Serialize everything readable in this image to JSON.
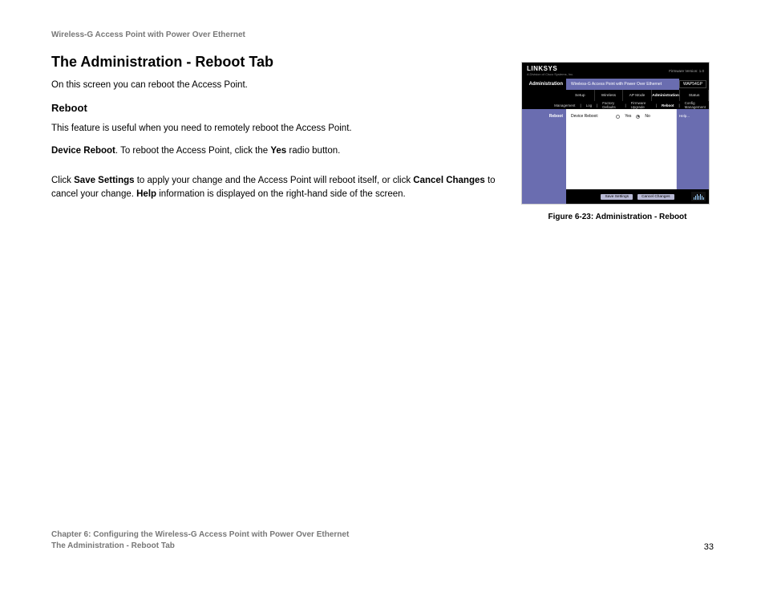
{
  "header": "Wireless-G Access Point with Power Over Ethernet",
  "title": "The Administration - Reboot Tab",
  "intro": "On this screen you can reboot the Access Point.",
  "subheading": "Reboot",
  "p1": "This feature is useful when you need to remotely reboot the Access Point.",
  "p2a": "Device Reboot",
  "p2b": ". To reboot the Access Point, click the ",
  "p2c": "Yes",
  "p2d": " radio button.",
  "p3a": "Click ",
  "p3b": "Save Settings",
  "p3c": " to apply your change and the Access Point will reboot itself, or click ",
  "p3d": "Cancel Changes",
  "p3e": " to cancel your change. ",
  "p3f": "Help",
  "p3g": " information is displayed on the right-hand side of the screen.",
  "figure": {
    "caption": "Figure 6-23: Administration - Reboot",
    "logo": "LINKSYS",
    "tagline": "A Division of Cisco Systems, Inc.",
    "fw": "Firmware Version: 1.0",
    "section": "Administration",
    "product": "Wireless-G Access Point with Power Over Ethernet",
    "model": "WAP54GP",
    "tabs": [
      "Setup",
      "Wireless",
      "AP Mode",
      "Administration",
      "Status"
    ],
    "subtabs": [
      "Management",
      "Log",
      "Factory Defaults",
      "Firmware Upgrade",
      "Reboot",
      "Config Management"
    ],
    "side_label": "Reboot",
    "field_label": "Device Reboot:",
    "opt_yes": "Yes",
    "opt_no": "No",
    "help": "Help...",
    "btn_save": "Save Settings",
    "btn_cancel": "Cancel Changes"
  },
  "footer": {
    "line1": "Chapter 6: Configuring the Wireless-G Access Point with Power Over Ethernet",
    "line2": "The Administration - Reboot Tab",
    "page": "33"
  }
}
